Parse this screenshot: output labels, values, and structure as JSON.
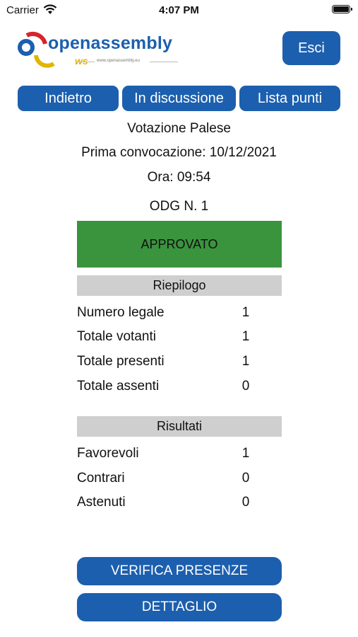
{
  "status_bar": {
    "carrier": "Carrier",
    "time": "4:07 PM"
  },
  "header": {
    "logo_text": "openassembly",
    "logo_sub": "ws",
    "logo_url": "www.openassembly.eu",
    "exit_label": "Esci"
  },
  "nav": {
    "back": "Indietro",
    "discussion": "In discussione",
    "list": "Lista punti"
  },
  "vote": {
    "type": "Votazione Palese",
    "convocation": "Prima convocazione: 10/12/2021",
    "time": "Ora: 09:54",
    "odg": "ODG N. 1",
    "result": "APPROVATO",
    "result_color": "#3a943d"
  },
  "summary": {
    "title": "Riepilogo",
    "rows": [
      {
        "label": "Numero legale",
        "value": "1"
      },
      {
        "label": "Totale votanti",
        "value": "1"
      },
      {
        "label": "Totale presenti",
        "value": "1"
      },
      {
        "label": "Totale assenti",
        "value": "0"
      }
    ]
  },
  "results": {
    "title": "Risultati",
    "rows": [
      {
        "label": "Favorevoli",
        "value": "1"
      },
      {
        "label": "Contrari",
        "value": "0"
      },
      {
        "label": "Astenuti",
        "value": "0"
      }
    ]
  },
  "actions": {
    "verify": "VERIFICA PRESENZE",
    "detail": "DETTAGLIO"
  },
  "colors": {
    "primary": "#1c5fae",
    "section_bg": "#cfcfcf",
    "logo_red": "#d8232a",
    "logo_yellow": "#e3b400"
  }
}
